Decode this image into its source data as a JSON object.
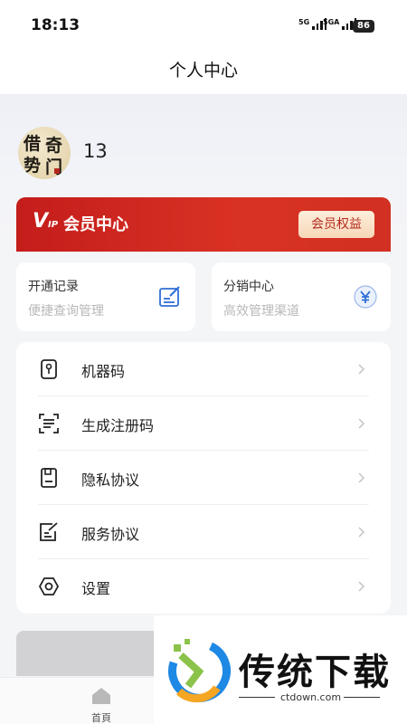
{
  "status": {
    "time": "18:13",
    "net1": "5G",
    "net2": "5GA",
    "battery": "86"
  },
  "header": {
    "title": "个人中心"
  },
  "profile": {
    "avatar_text": [
      "借",
      "奇",
      "势",
      "门"
    ],
    "username": "13"
  },
  "vip": {
    "logo_main": "V",
    "logo_small": "IP",
    "title": "会员中心",
    "button_label": "会员权益",
    "color": "#c41d1b"
  },
  "cards": [
    {
      "title": "开通记录",
      "subtitle": "便捷查询管理",
      "icon": "edit-note-icon"
    },
    {
      "title": "分销中心",
      "subtitle": "高效管理渠道",
      "icon": "yen-circle-icon"
    }
  ],
  "menu": [
    {
      "label": "机器码",
      "icon": "key-icon"
    },
    {
      "label": "生成注册码",
      "icon": "scan-code-icon"
    },
    {
      "label": "隐私协议",
      "icon": "document-icon"
    },
    {
      "label": "服务协议",
      "icon": "edit-document-icon"
    },
    {
      "label": "设置",
      "icon": "settings-icon"
    }
  ],
  "tabbar": {
    "home_label": "首頁"
  },
  "watermark": {
    "title": "传统下载",
    "subtitle": "ctdown.com"
  }
}
